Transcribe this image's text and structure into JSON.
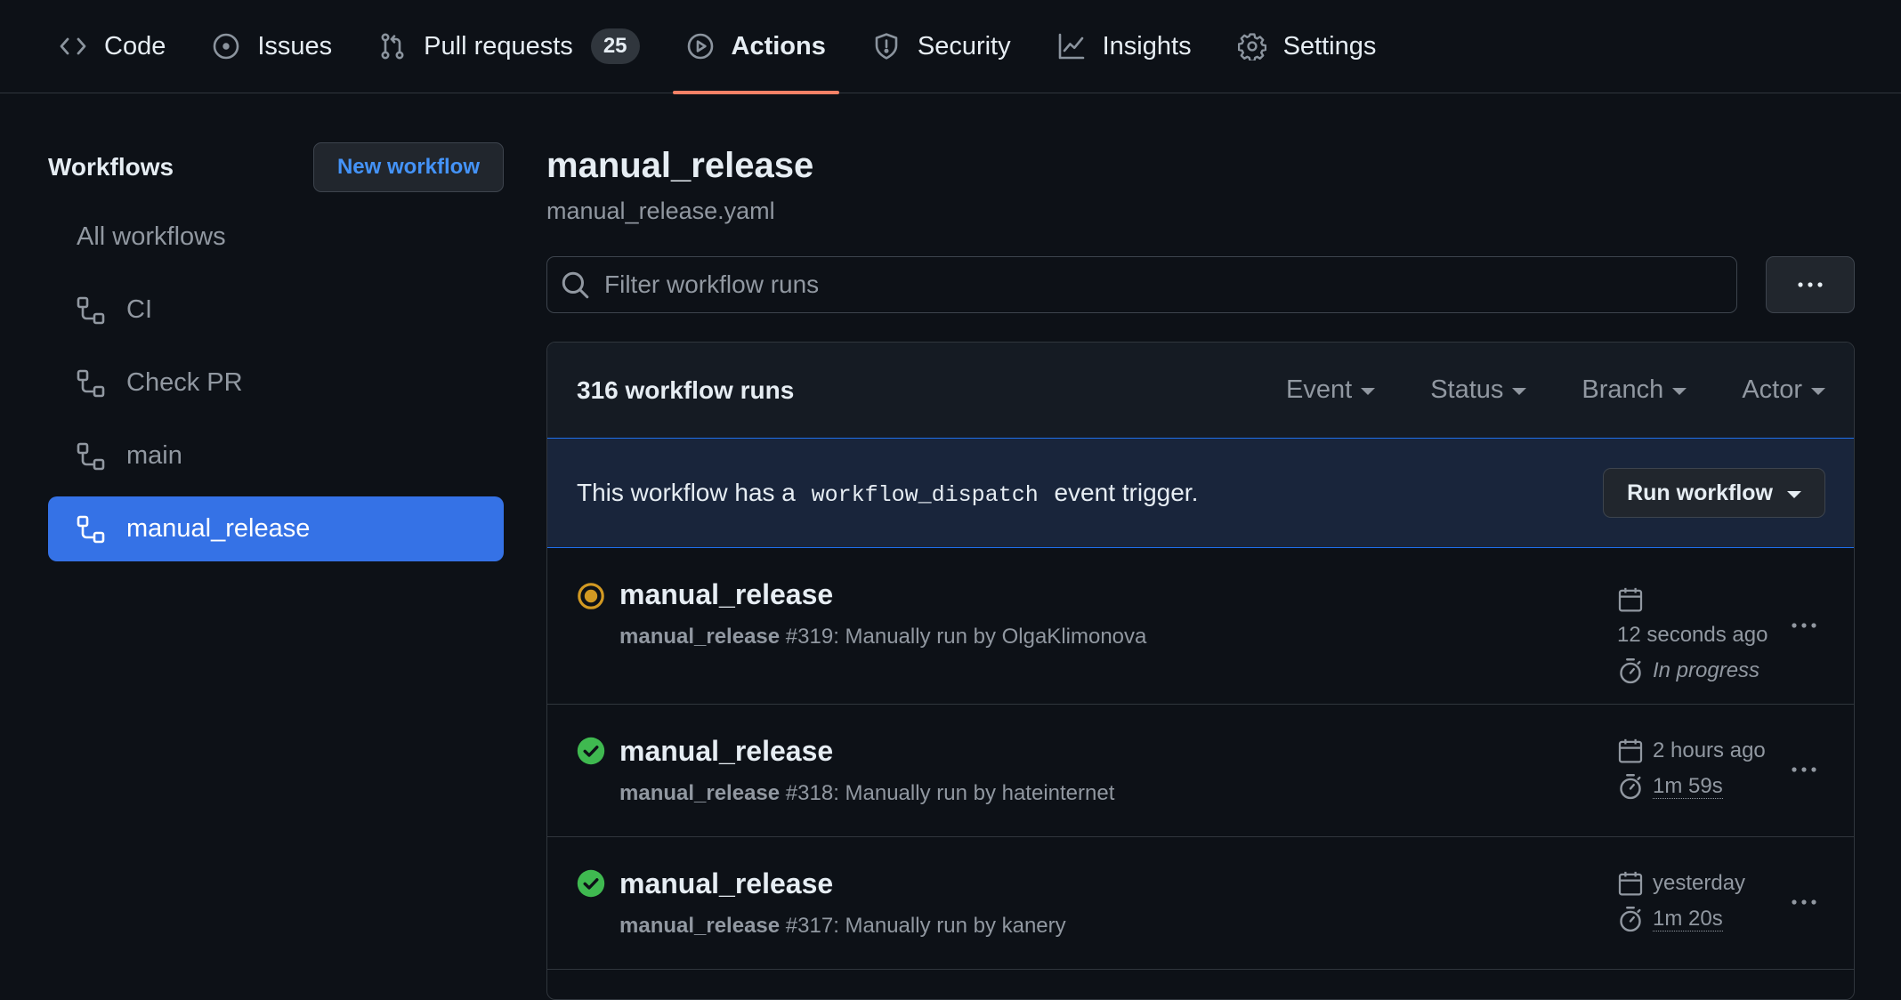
{
  "nav": {
    "tabs": [
      {
        "label": "Code",
        "icon": "code-icon"
      },
      {
        "label": "Issues",
        "icon": "issue-icon"
      },
      {
        "label": "Pull requests",
        "icon": "pull-request-icon",
        "counter": "25"
      },
      {
        "label": "Actions",
        "icon": "play-icon",
        "active": true
      },
      {
        "label": "Security",
        "icon": "shield-icon"
      },
      {
        "label": "Insights",
        "icon": "graph-icon"
      },
      {
        "label": "Settings",
        "icon": "gear-icon"
      }
    ],
    "active_underline_color": "#f78166"
  },
  "sidebar": {
    "title": "Workflows",
    "new_button": "New workflow",
    "items": [
      {
        "label": "All workflows"
      },
      {
        "label": "CI",
        "icon": "workflow-icon"
      },
      {
        "label": "Check PR",
        "icon": "workflow-icon"
      },
      {
        "label": "main",
        "icon": "workflow-icon"
      },
      {
        "label": "manual_release",
        "icon": "workflow-icon",
        "active": true
      }
    ],
    "active_color": "#3572e6"
  },
  "main": {
    "title": "manual_release",
    "subtitle": "manual_release.yaml",
    "filter_placeholder": "Filter workflow runs",
    "runs_count": "316 workflow runs",
    "filters": [
      "Event",
      "Status",
      "Branch",
      "Actor"
    ],
    "dispatch": {
      "prefix": "This workflow has a",
      "code": "workflow_dispatch",
      "suffix": "event trigger.",
      "button": "Run workflow"
    },
    "runs": [
      {
        "status": "in-progress",
        "status_icon": "in-progress-icon",
        "title": "manual_release",
        "workflow": "manual_release",
        "detail": "#319: Manually run by OlgaKlimonova",
        "when": "12 seconds ago",
        "duration": "In progress"
      },
      {
        "status": "success",
        "status_icon": "check-circle-icon",
        "title": "manual_release",
        "workflow": "manual_release",
        "detail": "#318: Manually run by hateinternet",
        "when": "2 hours ago",
        "duration": "1m 59s"
      },
      {
        "status": "success",
        "status_icon": "check-circle-icon",
        "title": "manual_release",
        "workflow": "manual_release",
        "detail": "#317: Manually run by kanery",
        "when": "yesterday",
        "duration": "1m 20s"
      }
    ],
    "colors": {
      "success": "#3fb950",
      "in_progress": "#d29922",
      "link": "#4493f8"
    }
  }
}
